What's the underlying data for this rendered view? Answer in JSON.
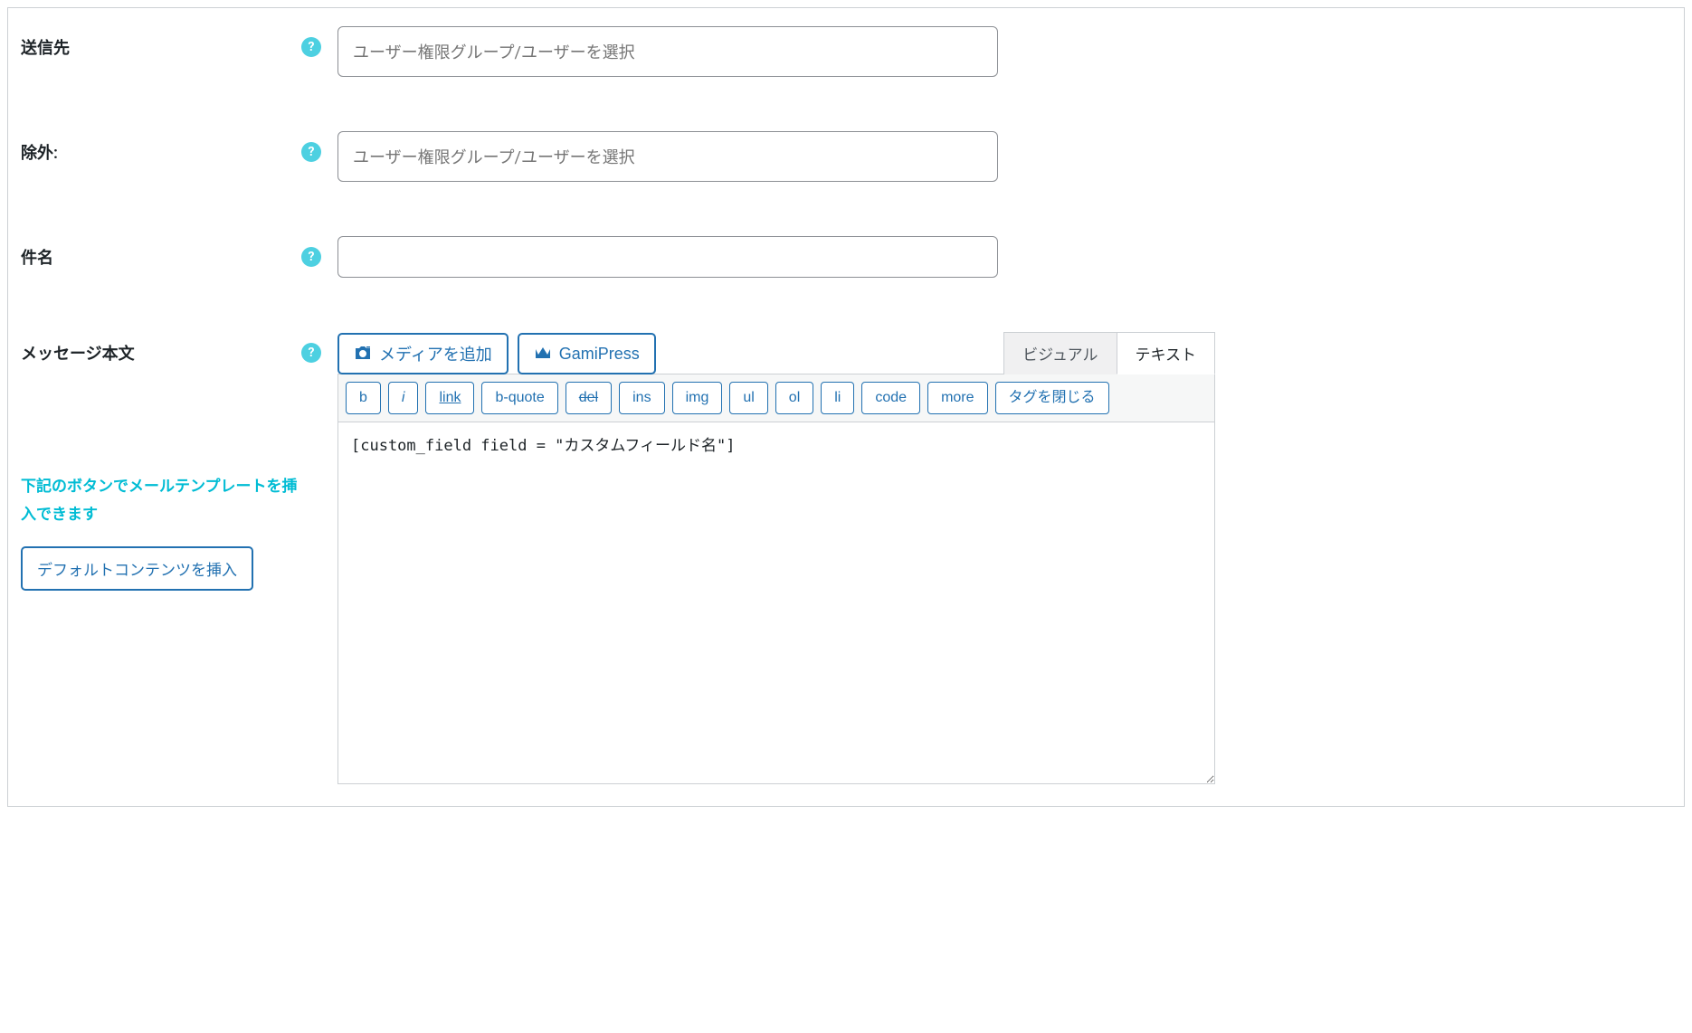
{
  "fields": {
    "recipient": {
      "label": "送信先",
      "placeholder": "ユーザー権限グループ/ユーザーを選択"
    },
    "exclude": {
      "label": "除外:",
      "placeholder": "ユーザー権限グループ/ユーザーを選択"
    },
    "subject": {
      "label": "件名",
      "value": ""
    },
    "body": {
      "label": "メッセージ本文",
      "content": "[custom_field field = \"カスタムフィールド名\"]"
    }
  },
  "buttons": {
    "add_media": "メディアを追加",
    "gamipress": "GamiPress",
    "insert_default": "デフォルトコンテンツを挿入"
  },
  "tabs": {
    "visual": "ビジュアル",
    "text": "テキスト"
  },
  "toolbar": {
    "b": "b",
    "i": "i",
    "link": "link",
    "bquote": "b-quote",
    "del": "del",
    "ins": "ins",
    "img": "img",
    "ul": "ul",
    "ol": "ol",
    "li": "li",
    "code": "code",
    "more": "more",
    "close_tags": "タグを閉じる"
  },
  "sidebar_note": "下記のボタンでメールテンプレートを挿入できます",
  "help_symbol": "?"
}
